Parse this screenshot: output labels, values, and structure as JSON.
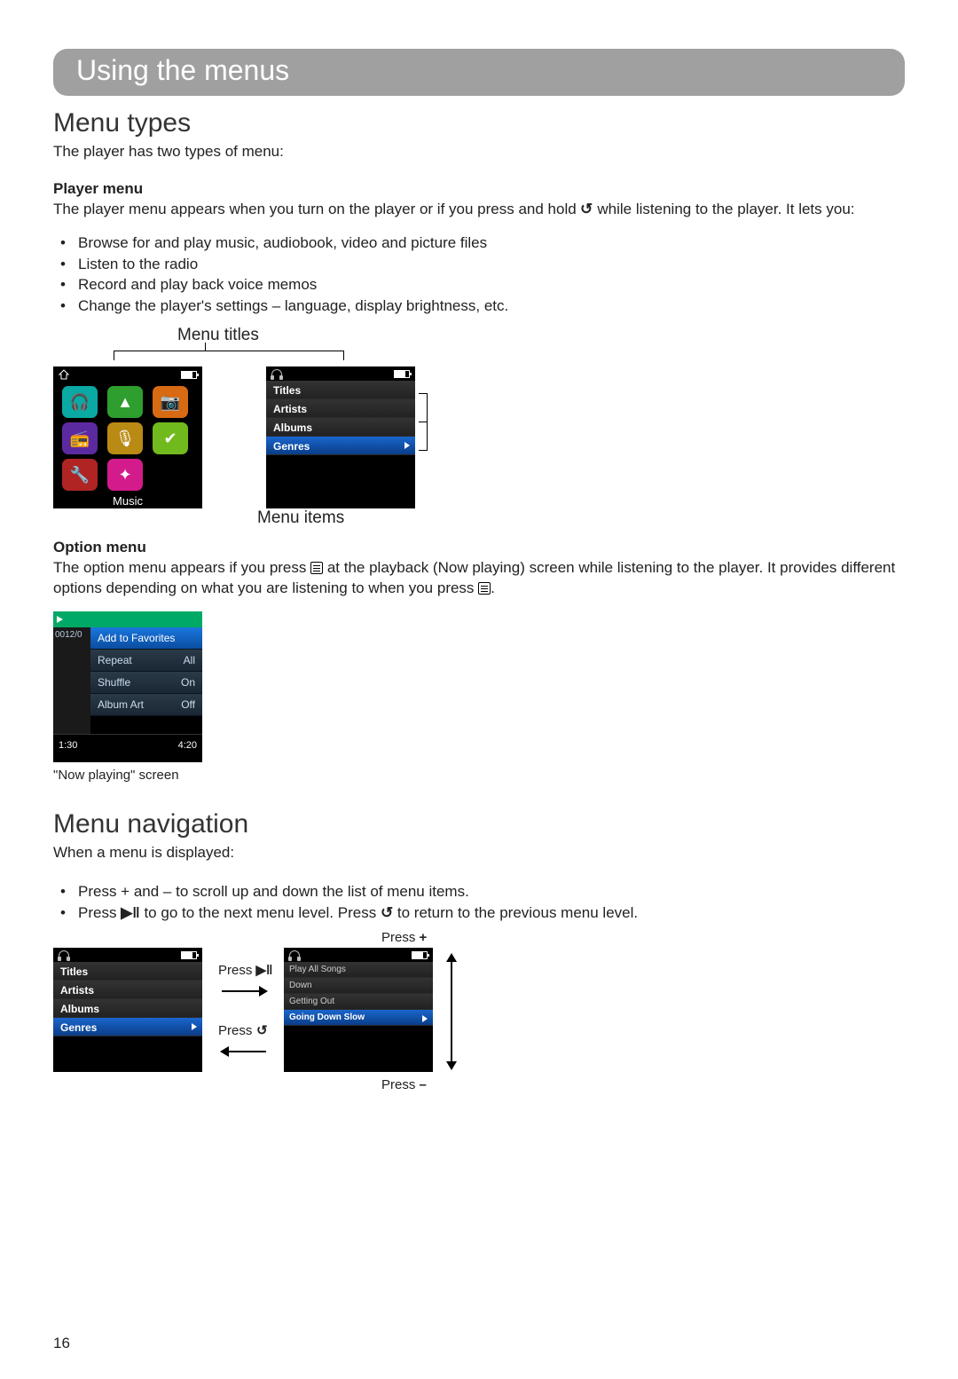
{
  "header": "Using the menus",
  "s1": {
    "title": "Menu types",
    "intro": "The player has two types of menu:",
    "playermenu_h": "Player menu",
    "playermenu_p1a": "The player menu appears when you turn on the player or if you press and hold ",
    "playermenu_p1b": " while listening to the player. It lets you:",
    "bullets": [
      "Browse for and play music, audiobook, video and picture files",
      "Listen to the radio",
      "Record and play back voice memos",
      "Change the player's settings – language, display brightness, etc."
    ],
    "label_titles": "Menu titles",
    "label_items": "Menu items",
    "icons_label": "Music",
    "list1": [
      "Titles",
      "Artists",
      "Albums",
      "Genres"
    ],
    "list1_sel": 3,
    "optionmenu_h": "Option menu",
    "optionmenu_p_a": "The option menu appears if you press ",
    "optionmenu_p_b": " at the playback (Now playing) screen while listening to the player. It provides different options depending on what you are listening to when you press ",
    "optionmenu_p_c": ".",
    "opt_side": "0012/0",
    "opt_rows": [
      {
        "l": "Add to Favorites",
        "r": ""
      },
      {
        "l": "Repeat",
        "r": "All"
      },
      {
        "l": "Shuffle",
        "r": "On"
      },
      {
        "l": "Album Art",
        "r": "Off"
      }
    ],
    "opt_sel": 0,
    "opt_t1": "1:30",
    "opt_t2": "4:20",
    "opt_caption": "\"Now playing\" screen"
  },
  "s2": {
    "title": "Menu navigation",
    "intro": "When a menu is displayed:",
    "b1": "Press + and – to scroll up and down the list of menu items.",
    "b2a": "Press ",
    "b2b": " to go to the next menu level. Press ",
    "b2c": " to return to the previous menu level.",
    "list2": [
      "Play All Songs",
      "Down",
      "Getting Out",
      "Going Down Slow"
    ],
    "list2_sel": 3,
    "lb_press": "Press",
    "lb_plus": "+",
    "lb_minus": "–"
  },
  "pagenum": "16"
}
